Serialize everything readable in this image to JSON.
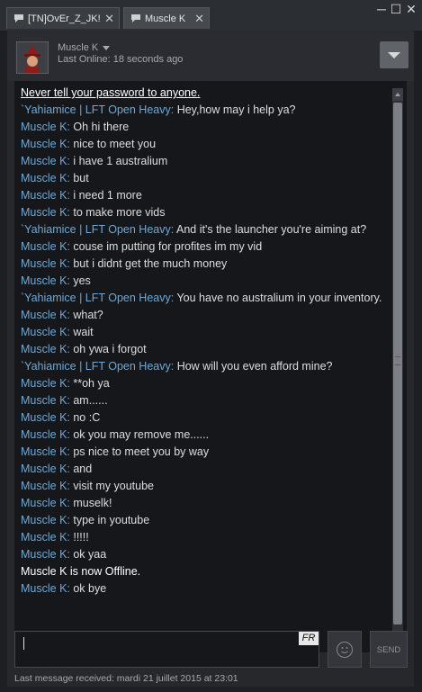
{
  "tabs": [
    {
      "label": "[TN]OvEr_Z_JK!",
      "close": "✕"
    },
    {
      "label": "Muscle K",
      "close": "✕"
    }
  ],
  "window_controls": {
    "minimize": "─",
    "maximize": "☐",
    "close": "✕"
  },
  "header": {
    "friend_name": "Muscle K",
    "last_online": "Last Online: 18 seconds ago"
  },
  "chat": [
    {
      "type": "system",
      "text": "Never tell your password to anyone.",
      "underline": true
    },
    {
      "type": "msg",
      "sender": "`Yahiamice | LFT Open Heavy",
      "text": "Hey,how may i help ya?"
    },
    {
      "type": "msg",
      "sender": "Muscle K",
      "text": "Oh hi there"
    },
    {
      "type": "msg",
      "sender": "Muscle K",
      "text": "nice to meet you"
    },
    {
      "type": "msg",
      "sender": "Muscle K",
      "text": "i have 1 australium"
    },
    {
      "type": "msg",
      "sender": "Muscle K",
      "text": "but"
    },
    {
      "type": "msg",
      "sender": "Muscle K",
      "text": "i need 1 more"
    },
    {
      "type": "msg",
      "sender": "Muscle K",
      "text": "to make more vids"
    },
    {
      "type": "msg",
      "sender": "`Yahiamice | LFT Open Heavy",
      "text": "And it's the launcher you're aiming at?"
    },
    {
      "type": "msg",
      "sender": "Muscle K",
      "text": "couse im putting for profites im my vid"
    },
    {
      "type": "msg",
      "sender": "Muscle K",
      "text": "but i didnt get the much money"
    },
    {
      "type": "msg",
      "sender": "Muscle K",
      "text": "yes"
    },
    {
      "type": "msg",
      "sender": "`Yahiamice | LFT Open Heavy",
      "text": "You have no australium in your inventory."
    },
    {
      "type": "msg",
      "sender": "Muscle K",
      "text": "what?"
    },
    {
      "type": "msg",
      "sender": "Muscle K",
      "text": "wait"
    },
    {
      "type": "msg",
      "sender": "Muscle K",
      "text": "oh ywa i forgot"
    },
    {
      "type": "msg",
      "sender": "`Yahiamice | LFT Open Heavy",
      "text": "How will you even afford mine?"
    },
    {
      "type": "msg",
      "sender": "Muscle K",
      "text": "**oh ya"
    },
    {
      "type": "msg",
      "sender": "Muscle K",
      "text": "am......"
    },
    {
      "type": "msg",
      "sender": "Muscle K",
      "text": "no :C"
    },
    {
      "type": "msg",
      "sender": "Muscle K",
      "text": "ok you may remove me......"
    },
    {
      "type": "msg",
      "sender": "Muscle K",
      "text": "ps nice to meet you by way"
    },
    {
      "type": "msg",
      "sender": "Muscle K",
      "text": "and"
    },
    {
      "type": "msg",
      "sender": "Muscle K",
      "text": "visit my youtube"
    },
    {
      "type": "msg",
      "sender": "Muscle K",
      "text": "muselk!"
    },
    {
      "type": "msg",
      "sender": "Muscle K",
      "text": "type in youtube"
    },
    {
      "type": "msg",
      "sender": "Muscle K",
      "text": "!!!!!"
    },
    {
      "type": "msg",
      "sender": "Muscle K",
      "text": "ok yaa"
    },
    {
      "type": "system",
      "text": "Muscle K is now Offline.",
      "underline": false
    },
    {
      "type": "msg",
      "sender": "Muscle K",
      "text": "ok bye"
    }
  ],
  "input": {
    "value": "",
    "language_badge": "FR"
  },
  "send_label": "SEND",
  "footer": "Last message received: mardi 21 juillet 2015 at 23:01",
  "colors": {
    "sender": "#6fa8d6",
    "background": "#16171a",
    "text": "#dcdedf"
  },
  "icons": {
    "tab": "chat-bubble-icon",
    "emoticon": "smiley-icon",
    "dropdown": "chevron-down-icon"
  }
}
